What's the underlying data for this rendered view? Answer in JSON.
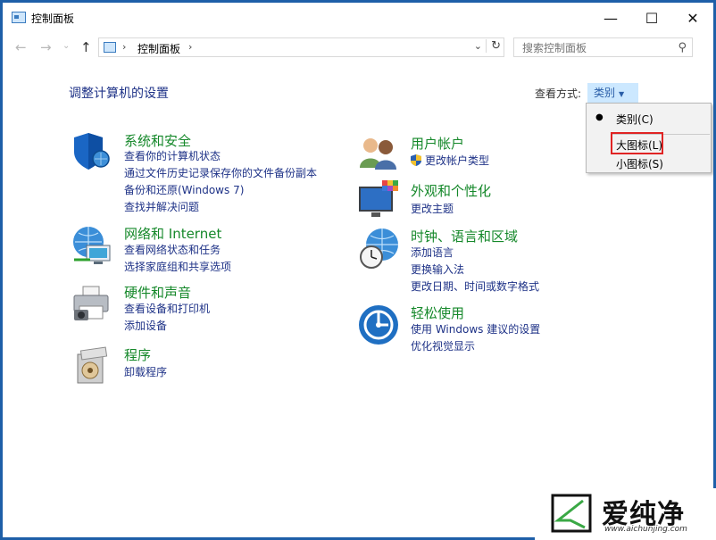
{
  "window": {
    "title": "控制面板",
    "minimize": "—",
    "maximize": "☐",
    "close": "✕"
  },
  "nav": {
    "back": "←",
    "forward": "→",
    "recent": "⌄",
    "up": "↑"
  },
  "address": {
    "sep1": "›",
    "crumb": "控制面板",
    "sep2": "›",
    "dropdown": "⌄",
    "refresh": "↻"
  },
  "search": {
    "placeholder": "搜索控制面板",
    "icon": "⚲"
  },
  "main": {
    "heading": "调整计算机的设置"
  },
  "view_by": {
    "label": "查看方式:",
    "selected": "类别",
    "arrow": "▼"
  },
  "dropdown": {
    "bullet": "●",
    "items": [
      "类别(C)",
      "大图标(L)",
      "小图标(S)"
    ]
  },
  "categories": [
    {
      "title": "系统和安全",
      "links": [
        "查看你的计算机状态",
        "通过文件历史记录保存你的文件备份副本",
        "备份和还原(Windows 7)",
        "查找并解决问题"
      ]
    },
    {
      "title": "网络和 Internet",
      "links": [
        "查看网络状态和任务",
        "选择家庭组和共享选项"
      ]
    },
    {
      "title": "硬件和声音",
      "links": [
        "查看设备和打印机",
        "添加设备"
      ]
    },
    {
      "title": "程序",
      "links": [
        "卸载程序"
      ]
    },
    {
      "title": "用户帐户",
      "links": [
        "更改帐户类型"
      ]
    },
    {
      "title": "外观和个性化",
      "links": [
        "更改主题"
      ]
    },
    {
      "title": "时钟、语言和区域",
      "links": [
        "添加语言",
        "更换输入法",
        "更改日期、时间或数字格式"
      ]
    },
    {
      "title": "轻松使用",
      "links": [
        "使用 Windows 建议的设置",
        "优化视觉显示"
      ]
    }
  ],
  "watermark": {
    "brand": "爱纯净",
    "url": "www.aichunjing.com"
  }
}
